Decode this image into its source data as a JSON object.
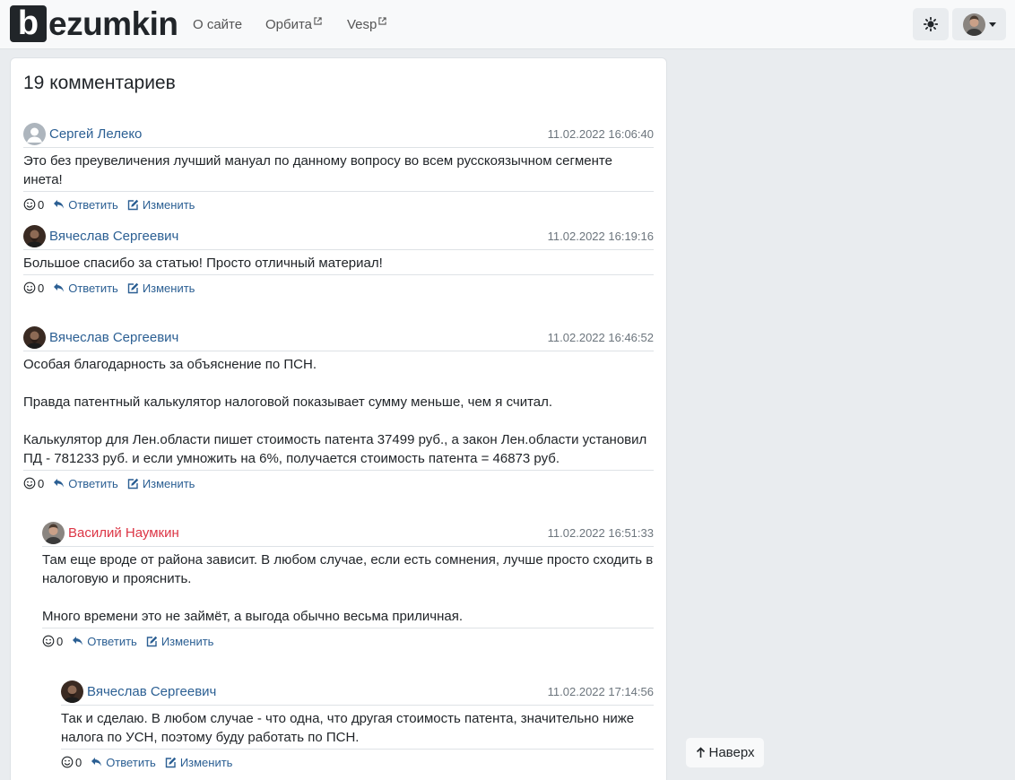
{
  "logo": {
    "letter": "b",
    "rest": "ezumkin"
  },
  "nav": {
    "about": "О сайте",
    "orbita": "Орбита",
    "vesp": "Vesp"
  },
  "comments_title": "19 комментариев",
  "comments": [
    {
      "author": "Сергей Лелеко",
      "date": "11.02.2022 16:06:40",
      "body": [
        "Это без преувеличения лучший мануал по данному вопросу во всем русскоязычном сегменте инета!"
      ],
      "likes": "0",
      "reply": "Ответить",
      "edit": "Изменить"
    },
    {
      "author": "Вячеслав Сергеевич",
      "date": "11.02.2022 16:19:16",
      "body": [
        "Большое спасибо за статью! Просто отличный материал!"
      ],
      "likes": "0",
      "reply": "Ответить",
      "edit": "Изменить"
    },
    {
      "author": "Вячеслав Сергеевич",
      "date": "11.02.2022 16:46:52",
      "body": [
        "Особая благодарность за объяснение по ПСН.",
        "Правда патентный калькулятор налоговой показывает сумму меньше, чем я считал.",
        "Калькулятор для Лен.области пишет стоимость патента 37499 руб., а закон Лен.области установил ПД - 781233 руб. и если умножить на 6%, получается стоимость патента = 46873 руб."
      ],
      "likes": "0",
      "reply": "Ответить",
      "edit": "Изменить"
    },
    {
      "author": "Василий Наумкин",
      "date": "11.02.2022 16:51:33",
      "body": [
        "Там еще вроде от района зависит. В любом случае, если есть сомнения, лучше просто сходить в налоговую и прояснить.",
        "Много времени это не займёт, а выгода обычно весьма приличная."
      ],
      "likes": "0",
      "reply": "Ответить",
      "edit": "Изменить"
    },
    {
      "author": "Вячеслав Сергеевич",
      "date": "11.02.2022 17:14:56",
      "body": [
        "Так и сделаю. В любом случае - что одна, что другая стоимость патента, значительно ниже налога по УСН, поэтому буду работать по ПСН."
      ],
      "likes": "0",
      "reply": "Ответить",
      "edit": "Изменить"
    }
  ],
  "back_to_top": "Наверх",
  "colors": {
    "link": "#2b5f93",
    "admin": "#dc3545",
    "page_bg": "#e9ecef"
  }
}
